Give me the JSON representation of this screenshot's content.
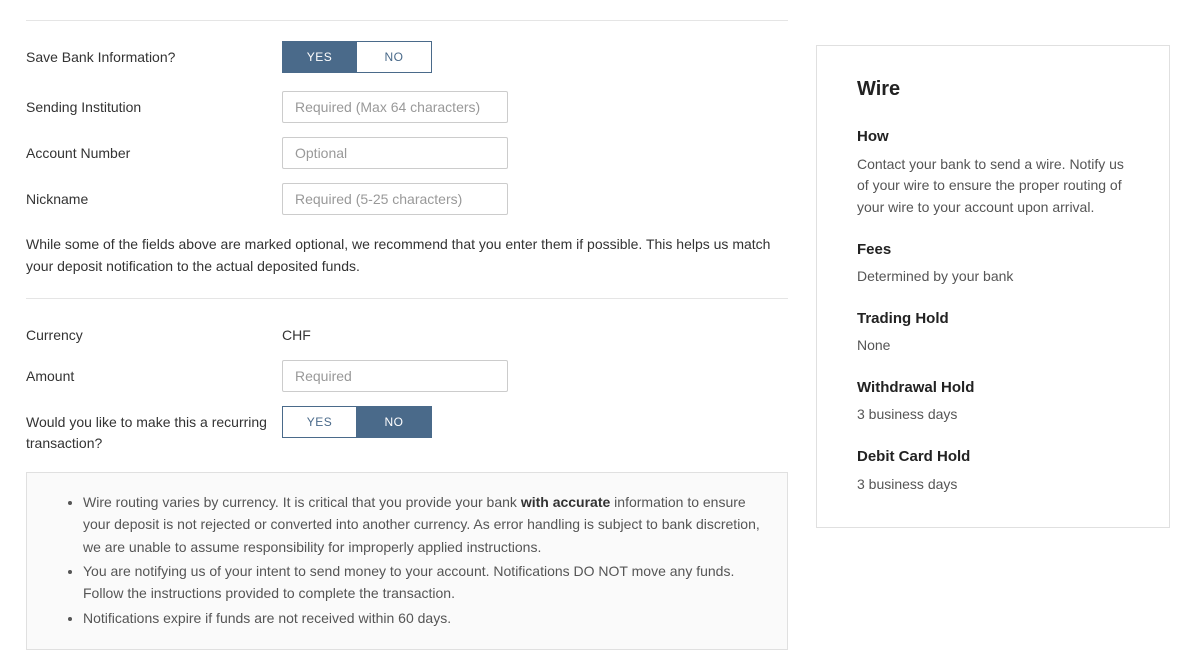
{
  "form": {
    "saveBankInfo": {
      "label": "Save Bank Information?",
      "yesLabel": "YES",
      "noLabel": "NO",
      "selected": "yes"
    },
    "sendingInstitution": {
      "label": "Sending Institution",
      "placeholder": "Required (Max 64 characters)",
      "value": ""
    },
    "accountNumber": {
      "label": "Account Number",
      "placeholder": "Optional",
      "value": ""
    },
    "nickname": {
      "label": "Nickname",
      "placeholder": "Required (5-25 characters)",
      "value": ""
    },
    "helpText": "While some of the fields above are marked optional, we recommend that you enter them if possible. This helps us match your deposit notification to the actual deposited funds.",
    "currency": {
      "label": "Currency",
      "value": "CHF"
    },
    "amount": {
      "label": "Amount",
      "placeholder": "Required",
      "value": ""
    },
    "recurring": {
      "label": "Would you like to make this a recurring transaction?",
      "yesLabel": "YES",
      "noLabel": "NO",
      "selected": "no"
    },
    "notice": {
      "item1_before": "Wire routing varies by currency. It is critical that you provide your bank ",
      "item1_bold": "with accurate",
      "item1_after": " information to ensure your deposit is not rejected or converted into another currency. As error handling is subject to bank discretion, we are unable to assume responsibility for improperly applied instructions.",
      "item2": "You are notifying us of your intent to send money to your account. Notifications DO NOT move any funds. Follow the instructions provided to complete the transaction.",
      "item3": "Notifications expire if funds are not received within 60 days."
    }
  },
  "sidebar": {
    "title": "Wire",
    "sections": [
      {
        "heading": "How",
        "body": "Contact your bank to send a wire. Notify us of your wire to ensure the proper routing of your wire to your account upon arrival."
      },
      {
        "heading": "Fees",
        "body": "Determined by your bank"
      },
      {
        "heading": "Trading Hold",
        "body": "None"
      },
      {
        "heading": "Withdrawal Hold",
        "body": "3 business days"
      },
      {
        "heading": "Debit Card Hold",
        "body": "3 business days"
      }
    ]
  }
}
